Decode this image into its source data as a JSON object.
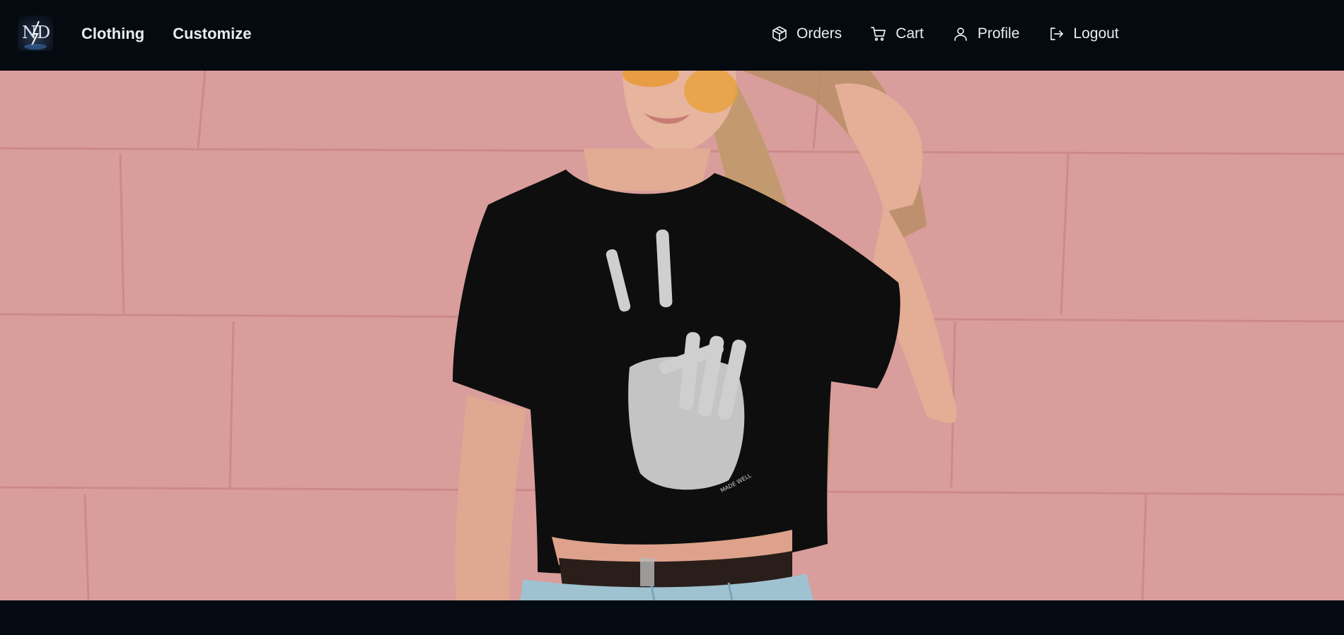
{
  "brand": {
    "logo_text": "ND",
    "logo_icon": "brand-logo-icon"
  },
  "nav": {
    "left": [
      {
        "label": "Clothing"
      },
      {
        "label": "Customize"
      }
    ],
    "right": [
      {
        "label": "Orders",
        "icon": "package-icon"
      },
      {
        "label": "Cart",
        "icon": "cart-icon"
      },
      {
        "label": "Profile",
        "icon": "user-icon"
      },
      {
        "label": "Logout",
        "icon": "logout-icon"
      }
    ]
  },
  "hero": {
    "image": "hero-photo",
    "shirt_print_text": "MADE WELL"
  },
  "colors": {
    "navbar_bg": "#040a0f",
    "page_bg": "#040b12",
    "nav_text": "#e8edf2",
    "wall": "#d89a9a",
    "shirt": "#0d0d0d"
  }
}
